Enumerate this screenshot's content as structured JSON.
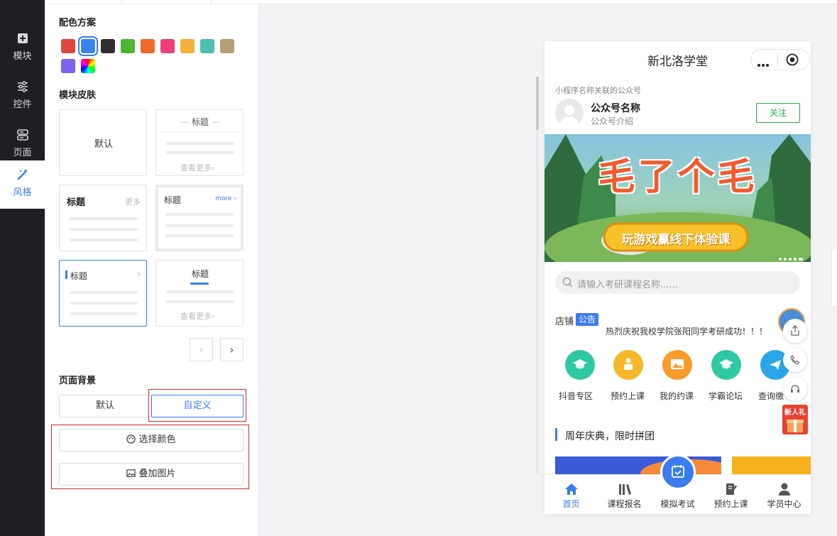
{
  "nav": {
    "items": [
      {
        "label": "模块",
        "icon": "plus-square-icon"
      },
      {
        "label": "控件",
        "icon": "sliders-icon"
      },
      {
        "label": "页面",
        "icon": "server-icon"
      },
      {
        "label": "风格",
        "icon": "magic-wand-icon"
      }
    ],
    "active": "风格"
  },
  "panel": {
    "color_scheme_title": "配色方案",
    "swatches": [
      "#e0463f",
      "#3b82f0",
      "#2f2f2f",
      "#4db634",
      "#f06a2c",
      "#ee3d7a",
      "#f4b13b",
      "#4dbeaf",
      "#b59f75",
      "#7d62ee",
      "rainbow"
    ],
    "selected_swatch": "#3b82f0",
    "skin_title": "模块皮肤",
    "skins": {
      "default_label": "默认",
      "title": "标题",
      "more": "更多",
      "more_en": "more",
      "view_more": "查看更多"
    },
    "pager": {
      "prev": "‹",
      "next": "›"
    },
    "bg_title": "页面背景",
    "bg_default": "默认",
    "bg_custom": "自定义",
    "pick_color": "选择颜色",
    "overlay_image": "叠加图片"
  },
  "phone": {
    "title": "新北洛学堂",
    "account_hint": "小程序名称关联的公众号",
    "account_name": "公众号名称",
    "account_desc": "公众号介绍",
    "follow": "关注",
    "banner_title": "毛了个毛",
    "banner_sub": "玩游戏赢线下体验课",
    "search_placeholder": "请输入考研课程名称......",
    "shop_label": "店铺",
    "notice_badge": "公告",
    "notice_text": "热烈庆祝我校学院张阳同学考研成功！！！",
    "icons": [
      {
        "label": "抖音专区",
        "color": "#2ec9a4"
      },
      {
        "label": "预约上课",
        "color": "#f7b72b"
      },
      {
        "label": "我的约课",
        "color": "#f79b2b"
      },
      {
        "label": "学霸论坛",
        "color": "#2ec9a4"
      },
      {
        "label": "查询缴",
        "color": "#2aa6e8"
      }
    ],
    "section_title": "周年庆典，限时拼团",
    "new_gift": "新人礼",
    "tabs": [
      {
        "label": "首页",
        "icon": "home-icon",
        "active": true
      },
      {
        "label": "课程报名",
        "icon": "books-icon",
        "active": false
      },
      {
        "label": "模拟考试",
        "icon": "calendar-check-icon",
        "active": false
      },
      {
        "label": "预约上课",
        "icon": "book-pen-icon",
        "active": false
      },
      {
        "label": "学员中心",
        "icon": "user-icon",
        "active": false
      }
    ],
    "accent": "#3b7cf0"
  }
}
